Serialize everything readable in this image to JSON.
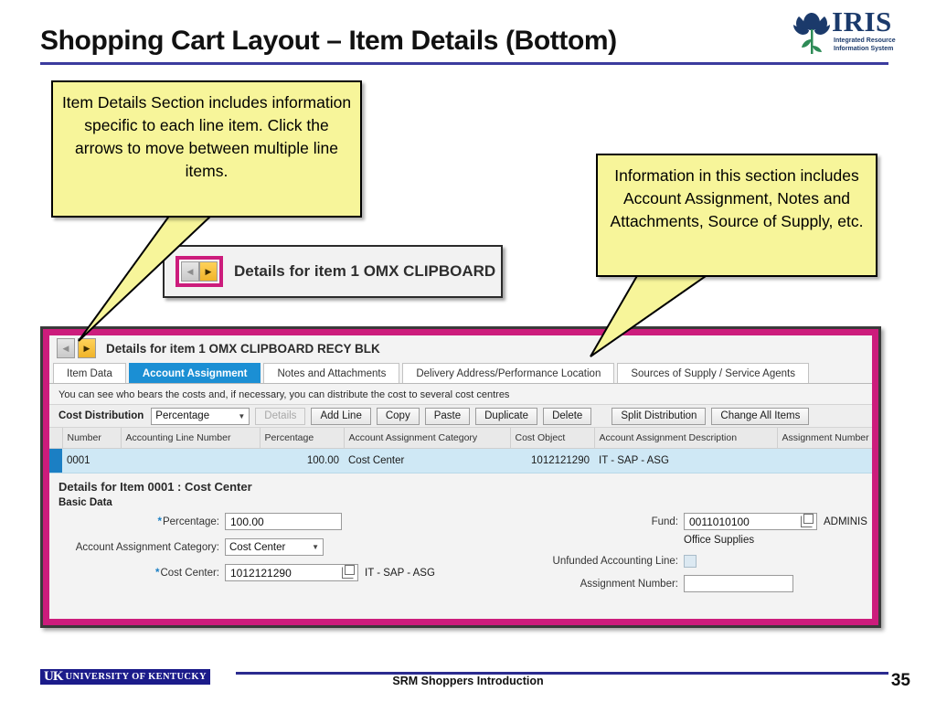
{
  "slide": {
    "title": "Shopping Cart Layout – Item Details (Bottom)",
    "page_number": "35",
    "footer_center": "SRM Shoppers Introduction",
    "accent_rule_color": "#3b3b9e",
    "highlight_color": "#cc1c7c"
  },
  "logo": {
    "wordmark": "IRIS",
    "subtitle_line1": "Integrated Resource",
    "subtitle_line2": "Information System"
  },
  "uk_logo": {
    "mark": "UK",
    "words": "UNIVERSITY OF KENTUCKY"
  },
  "callouts": [
    {
      "id": "item-details-section",
      "text": "Item Details Section includes information specific to each line item. Click the arrows to move between multiple line items."
    },
    {
      "id": "information-in-this-section",
      "text": "Information in this section includes Account Assignment, Notes and Attachments, Source of Supply, etc."
    }
  ],
  "zoom_snippet": {
    "prev_arrow": "prev-arrow-icon",
    "next_arrow": "next-arrow-icon",
    "label": "Details for item 1  OMX CLIPBOARD"
  },
  "sap": {
    "details_bar": {
      "prev_arrow": "prev-arrow-icon",
      "next_arrow": "next-arrow-icon",
      "title": "Details for item 1  OMX CLIPBOARD RECY BLK"
    },
    "tabs": [
      {
        "label": "Item Data",
        "active": false
      },
      {
        "label": "Account Assignment",
        "active": true
      },
      {
        "label": "Notes and Attachments",
        "active": false
      },
      {
        "label": "Delivery Address/Performance Location",
        "active": false
      },
      {
        "label": "Sources of Supply / Service Agents",
        "active": false
      }
    ],
    "helper_text": "You can see who bears the costs and, if necessary, you can distribute the cost to several cost centres",
    "toolbar": {
      "cost_distribution_label": "Cost Distribution",
      "cost_distribution_value": "Percentage",
      "buttons": [
        {
          "label": "Details",
          "disabled": true
        },
        {
          "label": "Add Line",
          "disabled": false
        },
        {
          "label": "Copy",
          "disabled": false
        },
        {
          "label": "Paste",
          "disabled": false
        },
        {
          "label": "Duplicate",
          "disabled": false
        },
        {
          "label": "Delete",
          "disabled": false
        }
      ],
      "buttons_right": [
        {
          "label": "Split Distribution",
          "disabled": false
        },
        {
          "label": "Change All Items",
          "disabled": false
        }
      ]
    },
    "table": {
      "columns": [
        "Number",
        "Accounting Line Number",
        "Percentage",
        "Account Assignment Category",
        "Cost Object",
        "Account Assignment Description",
        "Assignment Number"
      ],
      "rows": [
        {
          "number": "0001",
          "accounting_line_number": "",
          "percentage": "100.00",
          "account_assignment_category": "Cost Center",
          "cost_object": "1012121290",
          "account_assignment_description": "IT - SAP - ASG",
          "assignment_number": "",
          "selected": true
        }
      ]
    },
    "item_detail": {
      "heading": "Details for Item 0001 : Cost Center",
      "section_label": "Basic Data",
      "fields": {
        "percentage_label": "Percentage:",
        "percentage_value": "100.00",
        "account_assignment_category_label": "Account Assignment Category:",
        "account_assignment_category_value": "Cost Center",
        "cost_center_label": "Cost Center:",
        "cost_center_value": "1012121290",
        "cost_center_description": "IT - SAP - ASG",
        "fund_label": "Fund:",
        "fund_value": "0011010100",
        "fund_description": "ADMINIS",
        "fund_subtext": "Office Supplies",
        "unfunded_label": "Unfunded Accounting Line:",
        "assignment_number_label": "Assignment Number:",
        "assignment_number_value": ""
      }
    }
  }
}
